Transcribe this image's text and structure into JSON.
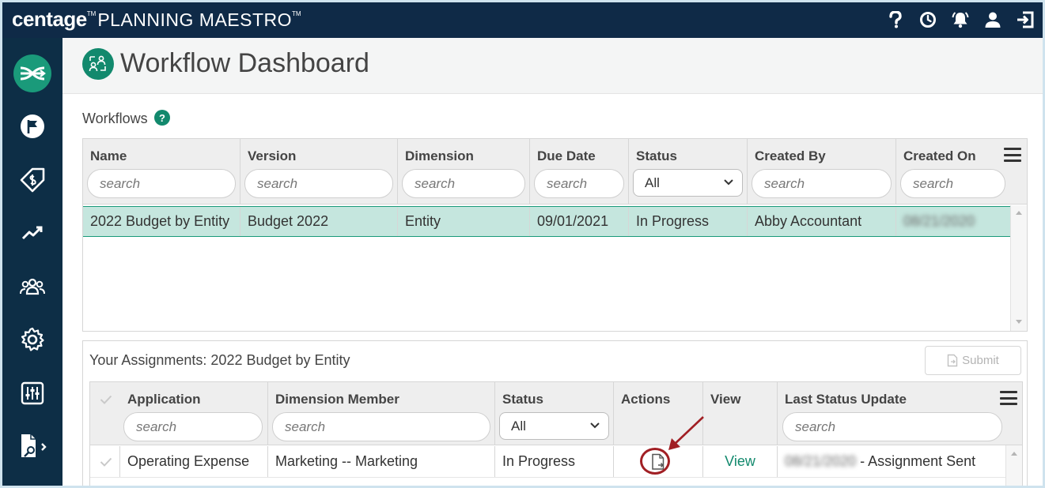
{
  "app": {
    "brand_primary": "centage",
    "brand_tm": "TM",
    "brand_secondary": "PLANNING MAESTRO",
    "brand_secondary_tm": "TM"
  },
  "top_icons": [
    "help-icon",
    "history-icon",
    "alerts-icon",
    "user-icon",
    "logout-icon"
  ],
  "sidebar": {
    "items": [
      "workflow-logo-icon",
      "flag-icon",
      "budget-tag-icon",
      "trend-icon",
      "team-icon",
      "settings-icon",
      "sliders-icon",
      "report-icon"
    ]
  },
  "page": {
    "title": "Workflow Dashboard"
  },
  "workflows": {
    "label": "Workflows",
    "help": "?",
    "columns": [
      "Name",
      "Version",
      "Dimension",
      "Due Date",
      "Status",
      "Created By",
      "Created On"
    ],
    "search_placeholder": "search",
    "status_filter": "All",
    "rows": [
      {
        "name": "2022 Budget by Entity",
        "version": "Budget 2022",
        "dimension": "Entity",
        "due_date": "09/01/2021",
        "status": "In Progress",
        "created_by": "Abby Accountant",
        "created_on": "08/21/2020"
      }
    ]
  },
  "assignments": {
    "title": "Your Assignments: 2022 Budget by Entity",
    "submit_label": "Submit",
    "columns": [
      "Application",
      "Dimension Member",
      "Status",
      "Actions",
      "View",
      "Last Status Update"
    ],
    "search_placeholder": "search",
    "status_filter": "All",
    "rows": [
      {
        "application": "Operating Expense",
        "dimension_member": "Marketing -- Marketing",
        "status": "In Progress",
        "view": "View",
        "last_update_date": "08/21/2020",
        "last_update_text": " - Assignment Sent"
      }
    ]
  },
  "colors": {
    "topbar": "#0f2a47",
    "sidebar": "#0d2e46",
    "accent": "#12896d",
    "selected_row": "#c5e6de",
    "annotation": "#a11f24"
  }
}
